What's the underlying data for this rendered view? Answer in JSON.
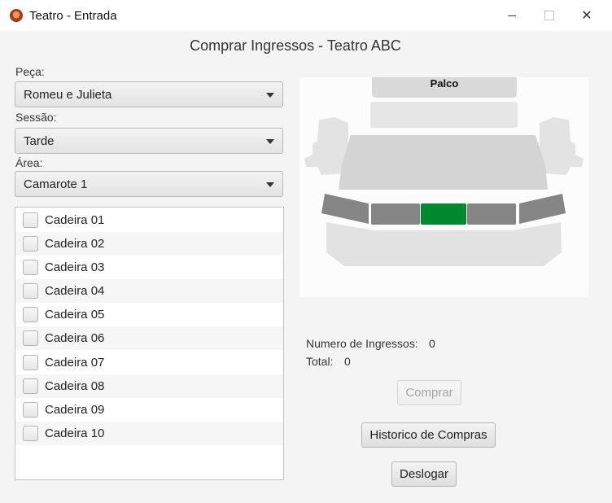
{
  "window": {
    "title": "Teatro - Entrada",
    "min_icon": "minimize-icon",
    "max_icon": "maximize-icon",
    "close_icon": "close-icon"
  },
  "heading": "Comprar Ingressos - Teatro ABC",
  "form": {
    "peca_label": "Peça:",
    "peca_value": "Romeu e Julieta",
    "sessao_label": "Sessão:",
    "sessao_value": "Tarde",
    "area_label": "Área:",
    "area_value": "Camarote 1"
  },
  "seats": [
    {
      "label": "Cadeira 01",
      "checked": false
    },
    {
      "label": "Cadeira 02",
      "checked": false
    },
    {
      "label": "Cadeira 03",
      "checked": false
    },
    {
      "label": "Cadeira 04",
      "checked": false
    },
    {
      "label": "Cadeira 05",
      "checked": false
    },
    {
      "label": "Cadeira 06",
      "checked": false
    },
    {
      "label": "Cadeira 07",
      "checked": false
    },
    {
      "label": "Cadeira 08",
      "checked": false
    },
    {
      "label": "Cadeira 09",
      "checked": false
    },
    {
      "label": "Cadeira 10",
      "checked": false
    }
  ],
  "map": {
    "stage_label": "Palco",
    "highlight_color": "#00892e"
  },
  "summary": {
    "num_label": "Numero de Ingressos:",
    "num_value": "0",
    "total_label": "Total:",
    "total_value": "0"
  },
  "buttons": {
    "comprar": "Comprar",
    "historico": "Historico de Compras",
    "deslogar": "Deslogar"
  }
}
